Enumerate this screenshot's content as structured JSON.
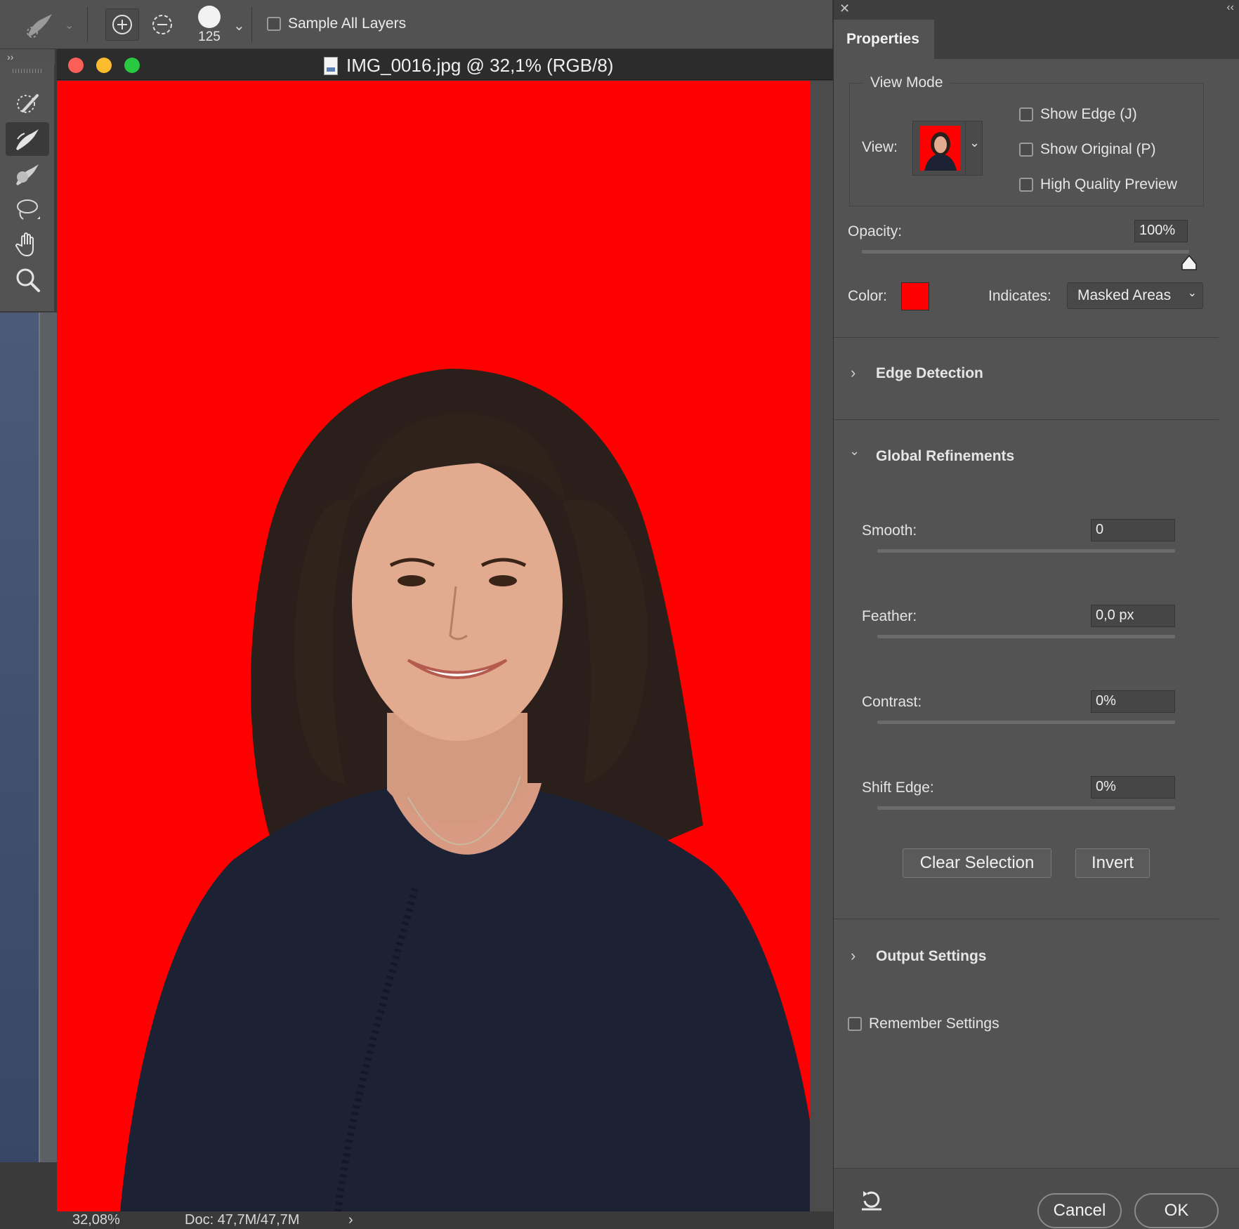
{
  "options_bar": {
    "brush_size": "125",
    "sample_all_layers_label": "Sample All Layers",
    "sample_all_layers_checked": false
  },
  "document": {
    "title": "IMG_0016.jpg @ 32,1% (RGB/8)",
    "zoom_status": "32,08%",
    "doc_size": "Doc: 47,7M/47,7M",
    "overlay_color": "#ff0000"
  },
  "properties": {
    "tab_label": "Properties",
    "view_mode": {
      "section_label": "View Mode",
      "view_label": "View:",
      "show_edge_label": "Show Edge (J)",
      "show_original_label": "Show Original (P)",
      "high_quality_label": "High Quality Preview"
    },
    "opacity": {
      "label": "Opacity:",
      "value": "100%",
      "level": 1.0
    },
    "color": {
      "label": "Color:",
      "swatch": "#ff0000"
    },
    "indicates": {
      "label": "Indicates:",
      "value": "Masked Areas"
    },
    "sections": {
      "edge_detection": "Edge Detection",
      "global_refinements": "Global Refinements",
      "output_settings": "Output Settings"
    },
    "refinements": {
      "smooth": {
        "label": "Smooth:",
        "value": "0",
        "level": 0.0
      },
      "feather": {
        "label": "Feather:",
        "value": "0,0 px",
        "level": 0.0
      },
      "contrast": {
        "label": "Contrast:",
        "value": "0%",
        "level": 0.0
      },
      "shift_edge": {
        "label": "Shift Edge:",
        "value": "0%",
        "level": 0.5
      }
    },
    "clear_selection_label": "Clear Selection",
    "invert_label": "Invert",
    "remember_settings_label": "Remember Settings",
    "cancel_label": "Cancel",
    "ok_label": "OK"
  },
  "icons": [
    "refine-brush-icon",
    "add-to-selection-icon",
    "subtract-from-selection-icon",
    "quick-selection-icon",
    "refine-edge-brush-icon",
    "brush-icon",
    "lasso-icon",
    "hand-icon",
    "zoom-icon",
    "reset-icon",
    "close-icon",
    "collapse-icon"
  ]
}
